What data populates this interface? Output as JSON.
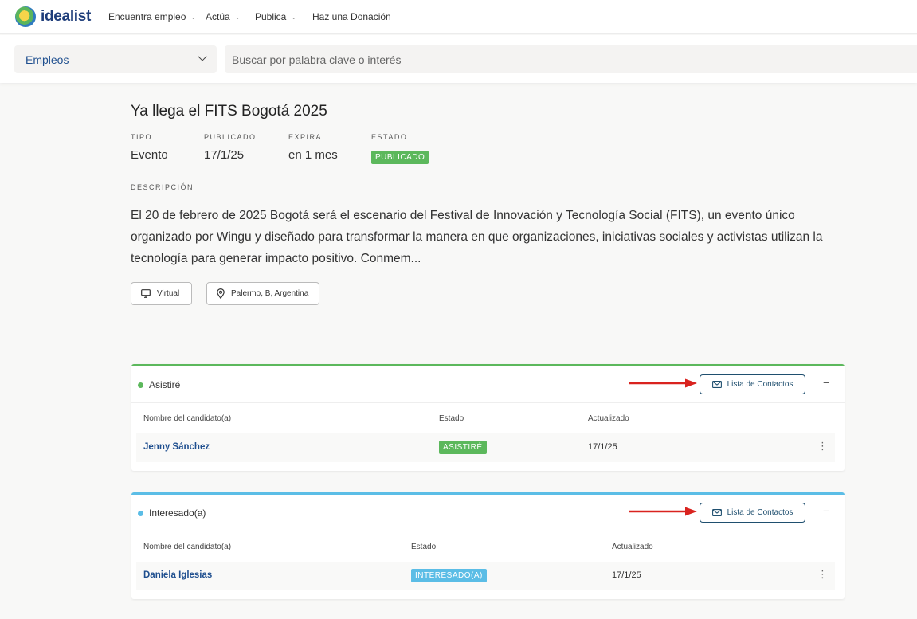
{
  "nav": {
    "logo_text": "idealist",
    "items": [
      "Encuentra empleo",
      "Actúa",
      "Publica",
      "Haz una Donación"
    ]
  },
  "search": {
    "category": "Empleos",
    "placeholder": "Buscar por palabra clave o interés"
  },
  "listing": {
    "title": "Ya llega el FITS Bogotá 2025",
    "meta": {
      "tipo_label": "TIPO",
      "tipo": "Evento",
      "publicado_label": "PUBLICADO",
      "publicado": "17/1/25",
      "expira_label": "EXPIRA",
      "expira": "en 1 mes",
      "estado_label": "ESTADO",
      "estado": "PUBLICADO"
    },
    "desc_label": "DESCRIPCIÓN",
    "description": "El 20 de febrero de 2025 Bogotá será el escenario del Festival de Innovación y Tecnología Social (FITS), un evento único organizado por Wingu y diseñado para transformar la manera en que organizaciones, iniciativas sociales y activistas utilizan la tecnología para generar impacto positivo. Conmem...",
    "chips": {
      "virtual": "Virtual",
      "location": "Palermo, B, Argentina"
    }
  },
  "panels": [
    {
      "title": "Asistiré",
      "button": "Lista de Contactos",
      "collapse": "−",
      "headers": {
        "name": "Nombre del candidato(a)",
        "status": "Estado",
        "updated": "Actualizado"
      },
      "row": {
        "name": "Jenny Sánchez",
        "status": "ASISTIRÉ",
        "updated": "17/1/25"
      }
    },
    {
      "title": "Interesado(a)",
      "button": "Lista de Contactos",
      "collapse": "−",
      "headers": {
        "name": "Nombre del candidato(a)",
        "status": "Estado",
        "updated": "Actualizado"
      },
      "row": {
        "name": "Daniela Iglesias",
        "status": "INTERESADO(A)",
        "updated": "17/1/25"
      }
    }
  ],
  "colors": {
    "green": "#5cb85c",
    "blue": "#5bbde6",
    "link": "#1f4f8f",
    "arrow": "#d9231f"
  }
}
